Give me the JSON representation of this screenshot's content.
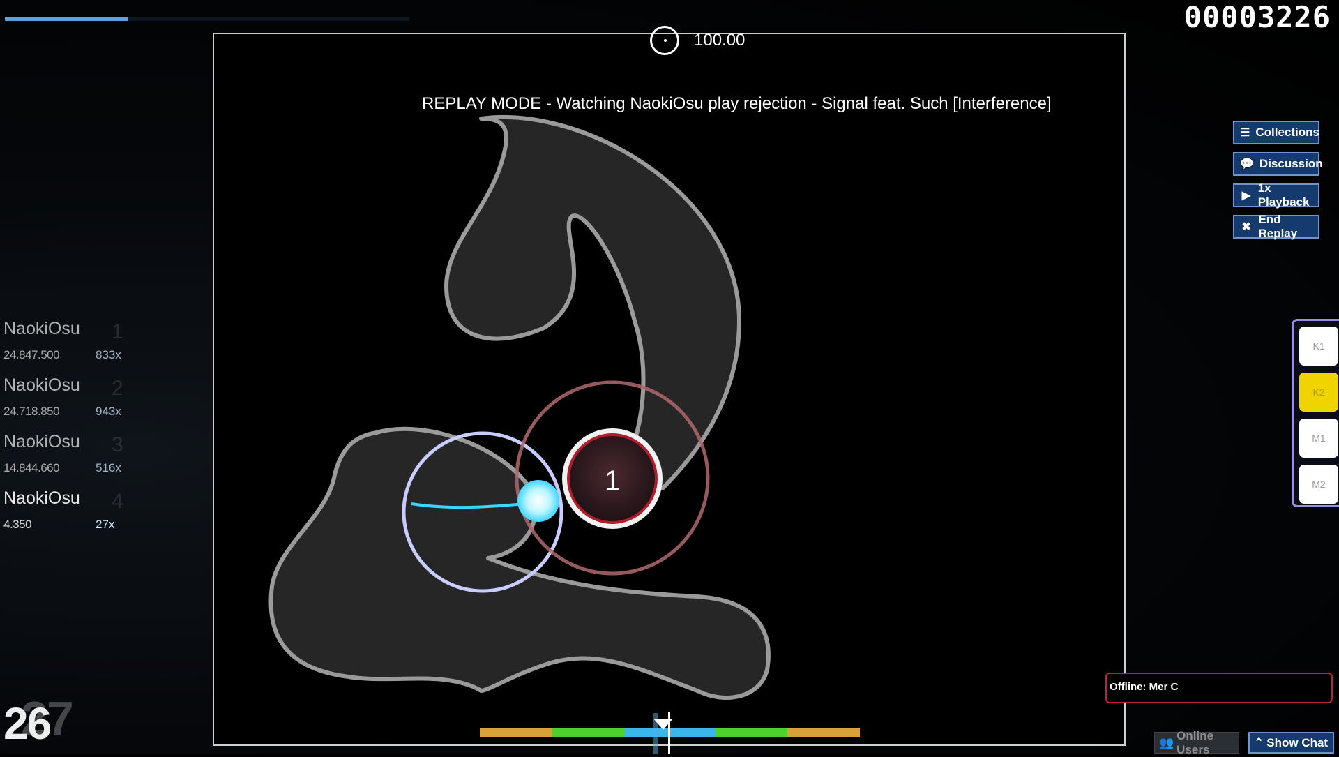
{
  "progress": {
    "fraction": 0.305
  },
  "score": "00003226",
  "accuracy": "100.00",
  "banner": "REPLAY MODE - Watching NaokiOsu play rejection - Signal feat. Such [Interference]",
  "side_buttons": [
    {
      "label": "Collections",
      "icon": "list-icon"
    },
    {
      "label": "Discussion",
      "icon": "chat-bubble-icon"
    },
    {
      "label": "1x Playback",
      "icon": "play-icon"
    },
    {
      "label": "End Replay",
      "icon": "close-icon"
    }
  ],
  "leaderboard": [
    {
      "name": "NaokiOsu",
      "rank": "1",
      "score": "24.847.500",
      "combo": "833x"
    },
    {
      "name": "NaokiOsu",
      "rank": "2",
      "score": "24.718.850",
      "combo": "943x"
    },
    {
      "name": "NaokiOsu",
      "rank": "3",
      "score": "14.844.660",
      "combo": "516x"
    },
    {
      "name": "NaokiOsu",
      "rank": "4",
      "score": "4.350",
      "combo": "27x"
    }
  ],
  "combo": {
    "current": "26",
    "previous": "27"
  },
  "keys": [
    {
      "label": "K1",
      "active": false
    },
    {
      "label": "K2",
      "active": true
    },
    {
      "label": "M1",
      "active": false
    },
    {
      "label": "M2",
      "active": false
    }
  ],
  "hit_number": "1",
  "notice": "Offline: Mer C",
  "bottom": {
    "online_users": "Online Users",
    "show_chat": "Show Chat"
  },
  "colors": {
    "accent": "#5aa3e8",
    "button_bg": "#143a6e",
    "key_active": "#f0d400",
    "notice_border": "#c61f2d",
    "hit_50": "#d7a237",
    "hit_100": "#4fd12d",
    "hit_300": "#3ab6ea"
  }
}
